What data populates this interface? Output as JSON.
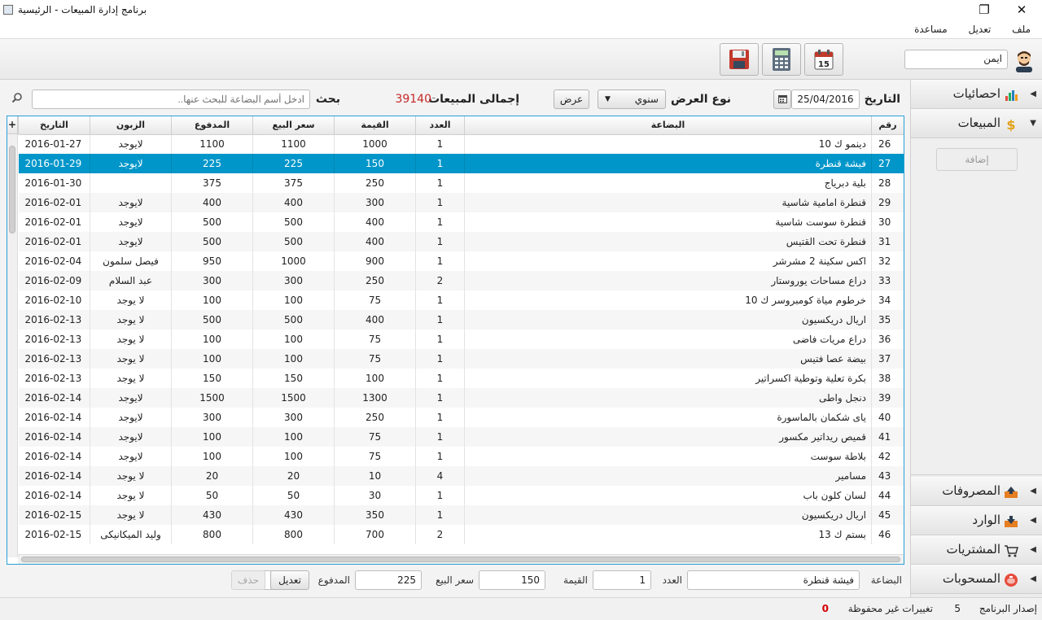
{
  "window": {
    "title": "برنامج إدارة المبيعات - الرئيسية",
    "restore_glyph": "❐",
    "close_glyph": "✕"
  },
  "menu": [
    "ملف",
    "تعديل",
    "مساعدة"
  ],
  "toolbar": {
    "user_name": "ايمن",
    "calendar_day": "15"
  },
  "filters": {
    "date_label": "التاريخ",
    "date_value": "25/04/2016",
    "view_type_label": "نوع العرض",
    "view_type_value": "سنوي",
    "show_button": "عرض",
    "total_label": "إجمالى المبيعات",
    "total_value": "39140",
    "search_label": "بحث",
    "search_placeholder": "ادخل أسم البضاعة للبحث عنها.."
  },
  "table": {
    "columns": {
      "num": "رقم",
      "item": "البضاعة",
      "count": "العدد",
      "value": "القيمة",
      "price": "سعر البيع",
      "paid": "المدفوع",
      "customer": "الزبون",
      "date": "التاريخ",
      "plus": "+"
    },
    "selected_index": 1,
    "rows": [
      {
        "num": "26",
        "item": "دينمو ك 10",
        "count": "1",
        "value": "1000",
        "price": "1100",
        "paid": "1100",
        "customer": "لايوجد",
        "date": "2016-01-27"
      },
      {
        "num": "27",
        "item": "فيشة قنطرة",
        "count": "1",
        "value": "150",
        "price": "225",
        "paid": "225",
        "customer": "لايوجد",
        "date": "2016-01-29"
      },
      {
        "num": "28",
        "item": "بلية دبرياج",
        "count": "1",
        "value": "250",
        "price": "375",
        "paid": "375",
        "customer": "",
        "date": "2016-01-30"
      },
      {
        "num": "29",
        "item": "قنطرة امامية شاسية",
        "count": "1",
        "value": "300",
        "price": "400",
        "paid": "400",
        "customer": "لايوجد",
        "date": "2016-02-01"
      },
      {
        "num": "30",
        "item": "قنطرة سوست شاسية",
        "count": "1",
        "value": "400",
        "price": "500",
        "paid": "500",
        "customer": "لايوجد",
        "date": "2016-02-01"
      },
      {
        "num": "31",
        "item": "قنطرة تحت القتيس",
        "count": "1",
        "value": "400",
        "price": "500",
        "paid": "500",
        "customer": "لايوجد",
        "date": "2016-02-01"
      },
      {
        "num": "32",
        "item": "اكس سكينة 2 مشرشر",
        "count": "1",
        "value": "900",
        "price": "1000",
        "paid": "950",
        "customer": "فيصل سلمون",
        "date": "2016-02-04"
      },
      {
        "num": "33",
        "item": "دراع مساحات يوروستار",
        "count": "2",
        "value": "250",
        "price": "300",
        "paid": "300",
        "customer": "عبد السلام",
        "date": "2016-02-09"
      },
      {
        "num": "34",
        "item": "خرطوم مياة كومبروسر ك 10",
        "count": "1",
        "value": "75",
        "price": "100",
        "paid": "100",
        "customer": "لا يوجد",
        "date": "2016-02-10"
      },
      {
        "num": "35",
        "item": "اريال دريكسيون",
        "count": "1",
        "value": "400",
        "price": "500",
        "paid": "500",
        "customer": "لا يوجد",
        "date": "2016-02-13"
      },
      {
        "num": "36",
        "item": "دراع مريات فاضى",
        "count": "1",
        "value": "75",
        "price": "100",
        "paid": "100",
        "customer": "لا يوجد",
        "date": "2016-02-13"
      },
      {
        "num": "37",
        "item": "بيضة عصا فتيس",
        "count": "1",
        "value": "75",
        "price": "100",
        "paid": "100",
        "customer": "لا يوجد",
        "date": "2016-02-13"
      },
      {
        "num": "38",
        "item": "بكرة تعلية وتوطية اكسراتير",
        "count": "1",
        "value": "100",
        "price": "150",
        "paid": "150",
        "customer": "لا يوجد",
        "date": "2016-02-13"
      },
      {
        "num": "39",
        "item": "دنجل واطى",
        "count": "1",
        "value": "1300",
        "price": "1500",
        "paid": "1500",
        "customer": "لايوجد",
        "date": "2016-02-14"
      },
      {
        "num": "40",
        "item": "ياى شكمان بالماسورة",
        "count": "1",
        "value": "250",
        "price": "300",
        "paid": "300",
        "customer": "لايوجد",
        "date": "2016-02-14"
      },
      {
        "num": "41",
        "item": "قميص ريداتير مكسور",
        "count": "1",
        "value": "75",
        "price": "100",
        "paid": "100",
        "customer": "لايوجد",
        "date": "2016-02-14"
      },
      {
        "num": "42",
        "item": "بلاطة سوست",
        "count": "1",
        "value": "75",
        "price": "100",
        "paid": "100",
        "customer": "لايوجد",
        "date": "2016-02-14"
      },
      {
        "num": "43",
        "item": "مسامير",
        "count": "4",
        "value": "10",
        "price": "20",
        "paid": "20",
        "customer": "لا يوجد",
        "date": "2016-02-14"
      },
      {
        "num": "44",
        "item": "لسان كلون باب",
        "count": "1",
        "value": "30",
        "price": "50",
        "paid": "50",
        "customer": "لا يوجد",
        "date": "2016-02-14"
      },
      {
        "num": "45",
        "item": "اريال دريكسيون",
        "count": "1",
        "value": "350",
        "price": "430",
        "paid": "430",
        "customer": "لا يوجد",
        "date": "2016-02-15"
      },
      {
        "num": "46",
        "item": "بستم ك 13",
        "count": "2",
        "value": "700",
        "price": "800",
        "paid": "800",
        "customer": "وليد الميكانيكى",
        "date": "2016-02-15"
      }
    ]
  },
  "editor": {
    "item_label": "البضاعة",
    "item_value": "فيشة قنطرة",
    "count_label": "العدد",
    "count_value": "1",
    "value_label": "القيمة",
    "value_value": "150",
    "price_label": "سعر البيع",
    "price_value": "225",
    "paid_label": "المدفوع",
    "paid_value": "225",
    "edit_button": "تعديل",
    "delete_button": "حذف"
  },
  "sidebar": {
    "stats": "احصائيات",
    "sales": "المبيعات",
    "add_button": "إضافة",
    "expenses": "المصروفات",
    "income": "الوارد",
    "purchases": "المشتريات",
    "withdrawals": "المسحوبات"
  },
  "status": {
    "version_label": "إصدار البرنامج",
    "version_value": "5",
    "unsaved_label": "تغييرات غير محفوظة",
    "unsaved_value": "0"
  },
  "colors": {
    "accent": "#0096c9",
    "total_red": "#c62828",
    "unsaved_red": "#d50000"
  }
}
